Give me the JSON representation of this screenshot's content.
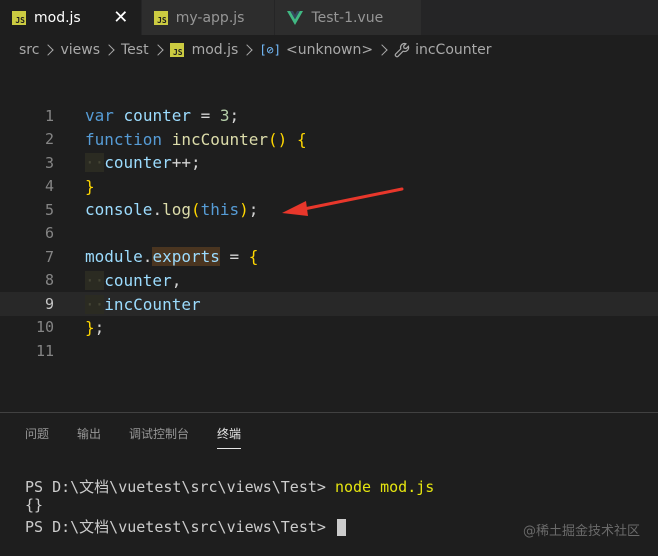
{
  "tabs": [
    {
      "label": "mod.js",
      "icon": "js-icon",
      "active": true,
      "close": "✕"
    },
    {
      "label": "my-app.js",
      "icon": "js-icon",
      "active": false
    },
    {
      "label": "Test-1.vue",
      "icon": "vue-icon",
      "active": false
    }
  ],
  "js_icon_text": "JS",
  "breadcrumb": {
    "items": [
      "src",
      "views",
      "Test",
      "mod.js",
      "<unknown>",
      "incCounter"
    ],
    "symbol_glyph": "[⊘]"
  },
  "editor": {
    "line_numbers": [
      "1",
      "2",
      "3",
      "4",
      "5",
      "6",
      "7",
      "8",
      "9",
      "10",
      "11"
    ],
    "current_line": "9",
    "lines": {
      "l1": {
        "kw": "var",
        "name": "counter",
        "op": " = ",
        "num": "3",
        "end": ";"
      },
      "l2": {
        "kw": "function",
        "fn": "incCounter",
        "paren": "()",
        "brace": "{"
      },
      "l3": {
        "ws": "··",
        "name": "counter",
        "rest": "++;"
      },
      "l4": {
        "brace": "}"
      },
      "l5": {
        "obj": "console",
        "dot": ".",
        "fn": "log",
        "open": "(",
        "kw": "this",
        "close": ")",
        "end": ";"
      },
      "l7": {
        "obj": "module",
        "dot": ".",
        "prop": "exports",
        "op": " = ",
        "brace": "{"
      },
      "l8": {
        "ws": "··",
        "name": "counter",
        "end": ","
      },
      "l9": {
        "ws": "··",
        "name": "incCounter"
      },
      "l10": {
        "brace": "}",
        "end": ";"
      }
    }
  },
  "panel": {
    "tabs": [
      "问题",
      "输出",
      "调试控制台",
      "终端"
    ],
    "active_tab": "终端",
    "terminal": {
      "line1_prompt": "PS D:\\文档\\vuetest\\src\\views\\Test> ",
      "line1_cmd": "node mod.js",
      "line2": "{}",
      "line3_prompt": "PS D:\\文档\\vuetest\\src\\views\\Test> "
    }
  },
  "watermark": "@稀土掘金技术社区",
  "colors": {
    "keyword": "#569cd6",
    "variable": "#9cdcfe",
    "function": "#dcdcaa",
    "number": "#b5cea8",
    "bracket": "#ffd700",
    "arrow": "#e8372b",
    "terminal_command": "#e5e510"
  }
}
